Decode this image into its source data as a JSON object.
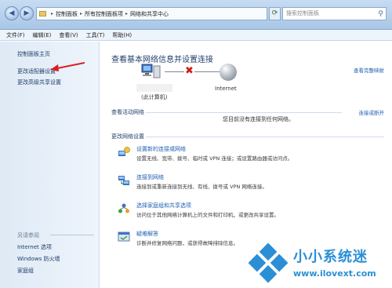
{
  "address_bar": {
    "breadcrumbs": [
      "控制面板",
      "所有控制面板项",
      "网络和共享中心"
    ],
    "search_placeholder": "搜索控制面板"
  },
  "menu": [
    "文件(F)",
    "编辑(E)",
    "查看(V)",
    "工具(T)",
    "帮助(H)"
  ],
  "sidebar": {
    "home": "控制面板主页",
    "change_adapter": "更改适配器设置",
    "change_sharing": "更改高级共享设置",
    "see_also_label": "另请参阅",
    "see_also": [
      "Internet 选项",
      "Windows 防火墙",
      "家庭组"
    ]
  },
  "main": {
    "title": "查看基本网络信息并设置连接",
    "full_map": "查看完整映射",
    "computer_label": "(此计算机)",
    "internet_label": "Internet",
    "active_networks_header": "查看活动网络",
    "connect_or_disconnect": "连接或断开",
    "no_network": "您目前没有连接到任何网络。",
    "change_settings_header": "更改网络设置",
    "tasks": [
      {
        "title": "设置新的连接或网络",
        "desc": "设置无线、宽带、拨号、临时或 VPN 连接；或设置路由器或访问点。"
      },
      {
        "title": "连接到网络",
        "desc": "连接到或重新连接到无线、有线、拨号或 VPN 网络连接。"
      },
      {
        "title": "选择家庭组和共享选项",
        "desc": "访问位于其他网络计算机上的文件和打印机，或更改共享设置。"
      },
      {
        "title": "疑难解答",
        "desc": "诊断并修复网络问题，或获得故障排除信息。"
      }
    ]
  },
  "watermark": {
    "brand": "小小系统迷",
    "url": "www.ilovext.com"
  }
}
